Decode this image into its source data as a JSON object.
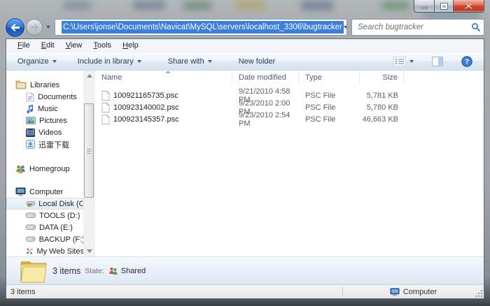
{
  "address_bar": {
    "path": "C:\\Users\\jonse\\Documents\\Navicat\\MySQL\\servers\\localhost_3306\\bugtracker",
    "search_placeholder": "Search bugtracker"
  },
  "menu": {
    "items": [
      {
        "label": "File"
      },
      {
        "label": "Edit"
      },
      {
        "label": "View"
      },
      {
        "label": "Tools"
      },
      {
        "label": "Help"
      }
    ]
  },
  "toolbar": {
    "organize": "Organize",
    "include_in_library": "Include in library",
    "share_with": "Share with",
    "new_folder": "New folder"
  },
  "columns": {
    "name": "Name",
    "date": "Date modified",
    "type": "Type",
    "size": "Size"
  },
  "files": [
    {
      "name": "100921165735.psc",
      "date": "9/21/2010 4:58 PM",
      "type": "PSC File",
      "size": "5,781 KB"
    },
    {
      "name": "100923140002.psc",
      "date": "9/23/2010 2:00 PM",
      "type": "PSC File",
      "size": "5,780 KB"
    },
    {
      "name": "100923145357.psc",
      "date": "9/23/2010 2:54 PM",
      "type": "PSC File",
      "size": "46,663 KB"
    }
  ],
  "sidebar": {
    "libraries": {
      "header": "Libraries",
      "items": [
        "Documents",
        "Music",
        "Pictures",
        "Videos",
        "迅雷下载"
      ]
    },
    "homegroup": {
      "header": "Homegroup"
    },
    "computer": {
      "header": "Computer",
      "items": [
        "Local Disk (C:)",
        "TOOLS (D:)",
        "DATA (E:)",
        "BACKUP (F:)",
        "My Web Sites on"
      ]
    },
    "selected_item": "Local Disk (C:)"
  },
  "details_pane": {
    "item_count": "3 items",
    "state_label": "State:",
    "state_value": "Shared"
  },
  "status_bar": {
    "left": "3 items",
    "right": "Computer"
  },
  "colors": {
    "selection_blue": "#3c7edb",
    "close_red": "#cf4530",
    "accent_glass": "#9fa5ab"
  }
}
